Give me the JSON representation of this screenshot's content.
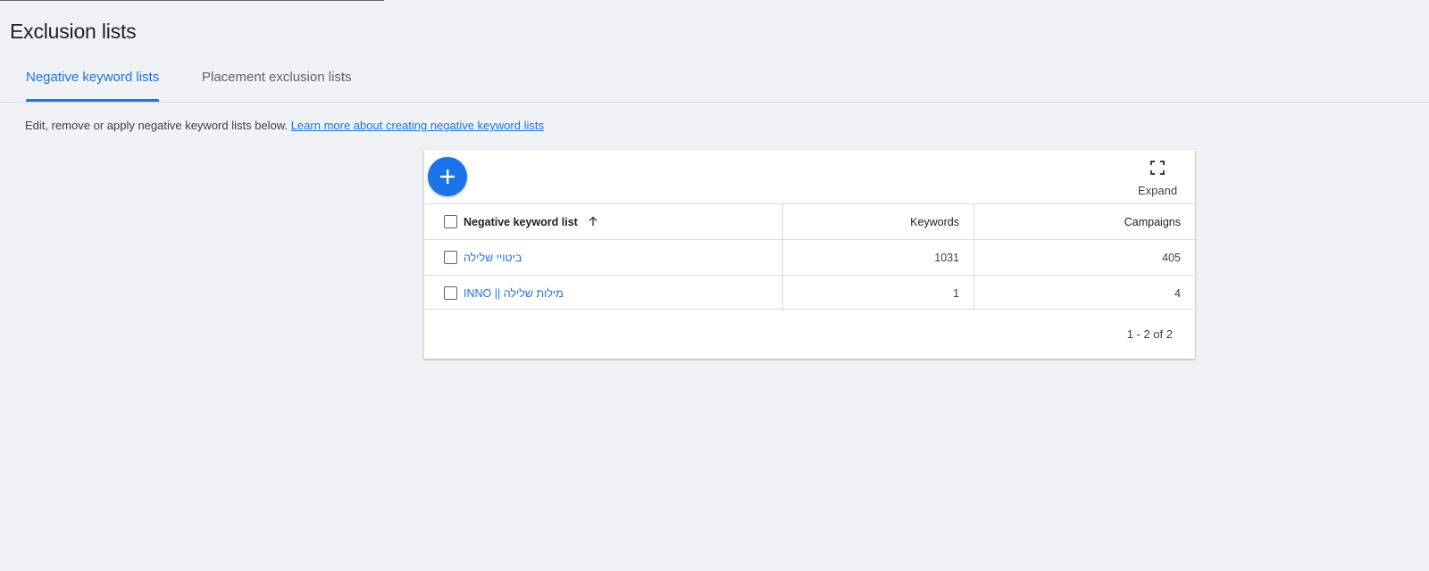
{
  "page": {
    "title": "Exclusion lists"
  },
  "tabs": [
    {
      "label": "Negative keyword lists",
      "selected": true
    },
    {
      "label": "Placement exclusion lists",
      "selected": false
    }
  ],
  "intro": {
    "text": "Edit, remove or apply negative keyword lists below. ",
    "link": "Learn more about creating negative keyword lists"
  },
  "toolbar": {
    "add_icon": "plus-icon",
    "expand_icon": "fullscreen-icon",
    "expand_label": "Expand"
  },
  "table": {
    "columns": {
      "name": "Negative keyword list",
      "keywords": "Keywords",
      "campaigns": "Campaigns"
    },
    "sort": {
      "column": "name",
      "direction": "ascending",
      "icon": "arrow-up-icon"
    },
    "rows": [
      {
        "name": "ביטויי שלילה",
        "keywords": "1031",
        "campaigns": "405"
      },
      {
        "name": "מילות שלילה || INNO",
        "keywords": "1",
        "campaigns": "4"
      }
    ]
  },
  "pagination": {
    "text": "1 - 2 of 2"
  },
  "colors": {
    "accent": "#1a73e8",
    "background": "#f0f2f5",
    "text": "#202124"
  }
}
